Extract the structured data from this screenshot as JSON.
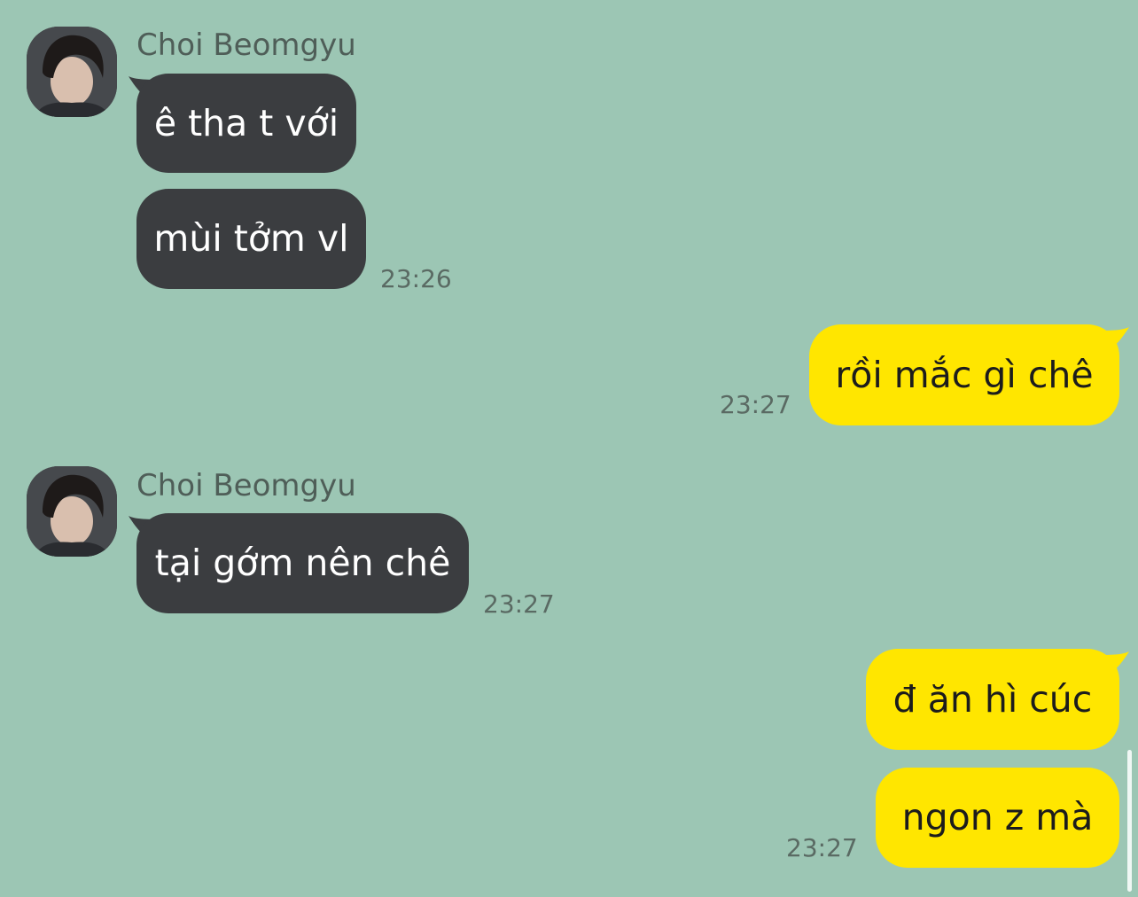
{
  "colors": {
    "background": "#9cc6b4",
    "incoming_bubble": "#3b3d40",
    "outgoing_bubble": "#ffe600"
  },
  "groups": [
    {
      "sender": "Choi Beomgyu",
      "messages": [
        "ê tha t với",
        "mùi tởm vl"
      ],
      "time": "23:26"
    },
    {
      "messages": [
        "rồi mắc gì chê"
      ],
      "time": "23:27"
    },
    {
      "sender": "Choi Beomgyu",
      "messages": [
        "tại gớm nên chê"
      ],
      "time": "23:27"
    },
    {
      "messages": [
        "đ ăn hì cúc",
        "ngon z mà"
      ],
      "time": "23:27"
    }
  ]
}
